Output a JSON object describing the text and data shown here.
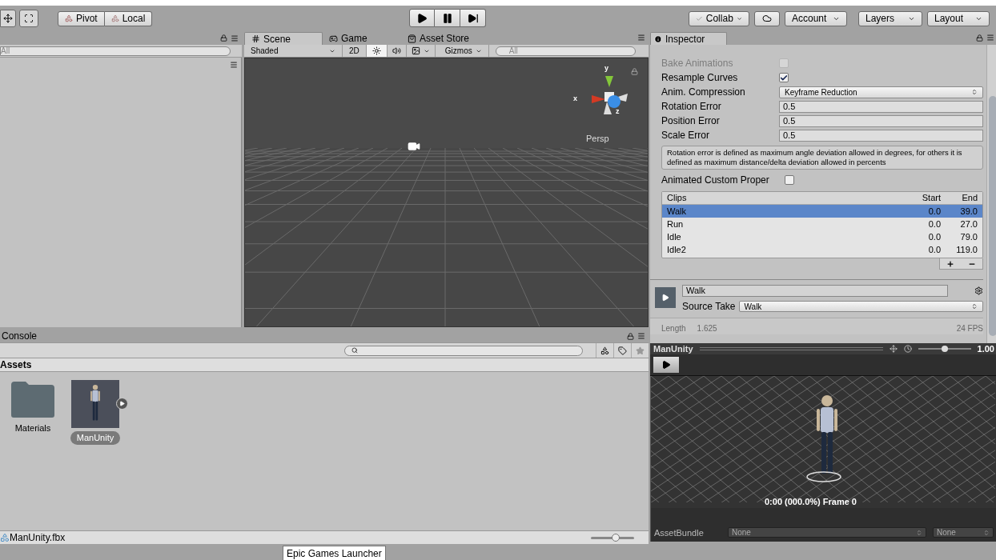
{
  "toolbar": {
    "pivot": "Pivot",
    "local": "Local",
    "collab": "Collab",
    "account": "Account",
    "layers": "Layers",
    "layout": "Layout"
  },
  "hierarchy": {
    "search": {
      "placeholder": "All"
    }
  },
  "scene": {
    "tabs": [
      {
        "label": "Scene",
        "selected": true,
        "kind": "scene"
      },
      {
        "label": "Game",
        "selected": false,
        "kind": "game"
      },
      {
        "label": "Asset Store",
        "selected": false,
        "kind": "store"
      }
    ],
    "shading": "Shaded",
    "mode_2d": "2D",
    "lighting_on": true,
    "audio_on": false,
    "gizmos": "Gizmos",
    "search": {
      "placeholder": "All"
    },
    "axes": {
      "y": "y",
      "x": "x",
      "z": "z"
    },
    "projection": "Persp"
  },
  "inspector": {
    "title": "Inspector",
    "properties": [
      {
        "kind": "checkbox",
        "label": "Bake Animations",
        "checked": false,
        "disabled": true
      },
      {
        "kind": "checkbox",
        "label": "Resample Curves",
        "checked": true,
        "disabled": false
      },
      {
        "kind": "dropdown",
        "label": "Anim. Compression",
        "value": "Keyframe Reduction"
      },
      {
        "kind": "number",
        "label": "Rotation Error",
        "value": "0.5"
      },
      {
        "kind": "number",
        "label": "Position Error",
        "value": "0.5"
      },
      {
        "kind": "number",
        "label": "Scale Error",
        "value": "0.5"
      },
      {
        "kind": "help",
        "text": "Rotation error is defined as maximum angle deviation allowed in degrees, for others it is defined as maximum distance/delta deviation allowed in percents"
      },
      {
        "kind": "checkbox",
        "label": "Animated Custom Proper",
        "checked": false,
        "disabled": false
      }
    ],
    "clips": {
      "columns": [
        "Clips",
        "Start",
        "End"
      ],
      "rows": [
        {
          "name": "Walk",
          "start": "0.0",
          "end": "39.0",
          "selected": true
        },
        {
          "name": "Run",
          "start": "0.0",
          "end": "27.0",
          "selected": false
        },
        {
          "name": "Idle",
          "start": "0.0",
          "end": "79.0",
          "selected": false
        },
        {
          "name": "Idle2",
          "start": "0.0",
          "end": "119.0",
          "selected": false
        }
      ]
    },
    "clip": {
      "name": "Walk",
      "source_take_label": "Source Take",
      "source_take": "Walk",
      "length_label": "Length",
      "length": "1.625",
      "fps": "24 FPS"
    }
  },
  "preview": {
    "title": "ManUnity",
    "speed": {
      "level": 0.5,
      "reading": "1.00"
    },
    "frame": "0:00 (000.0%) Frame 0",
    "asset_bundle": {
      "label": "AssetBundle",
      "name": "None",
      "variant": "None"
    }
  },
  "console": {
    "title": "Console"
  },
  "project": {
    "breadcrumb": "Assets",
    "items": [
      {
        "label": "Materials",
        "kind": "folder",
        "selected": false
      },
      {
        "label": "ManUnity",
        "kind": "model",
        "selected": true
      }
    ],
    "selected_path": "ManUnity.fbx",
    "zoom": {
      "level": 0.58
    }
  },
  "taskbar": {
    "tooltip": "Epic Games Launcher"
  }
}
